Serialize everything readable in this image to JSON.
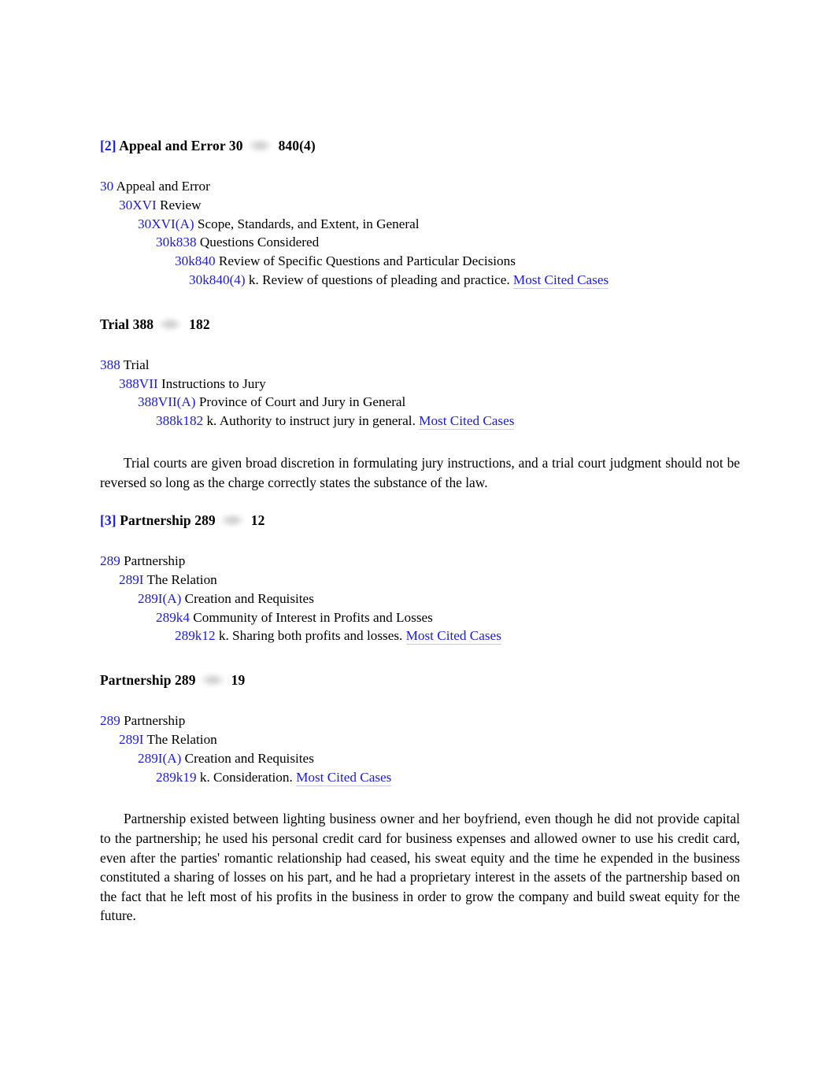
{
  "document": {
    "type": "westlaw-headnotes",
    "link_color": "#1a1ae8",
    "text_color": "#000000",
    "background": "#ffffff"
  },
  "sections": [
    {
      "header": {
        "bracket": "[2]",
        "topic": "Appeal and Error",
        "topic_number": "30",
        "key_icon": "west-key-icon",
        "key_number": "840(4)"
      },
      "outline": [
        {
          "code": "30",
          "desc": "Appeal and Error"
        },
        {
          "code": "30XVI",
          "desc": "Review"
        },
        {
          "code": "30XVI(A)",
          "desc": "Scope, Standards, and Extent, in General"
        },
        {
          "code": "30k838",
          "desc": "Questions Considered"
        },
        {
          "code": "30k840",
          "desc": "Review of Specific Questions and Particular Decisions"
        },
        {
          "code": "30k840(4)",
          "desc": "k. Review of questions of pleading and practice.",
          "link": "Most Cited Cases"
        }
      ],
      "body": null
    },
    {
      "header": {
        "bracket": "",
        "topic": "Trial",
        "topic_number": "388",
        "key_icon": "west-key-icon",
        "key_number": "182"
      },
      "outline": [
        {
          "code": "388",
          "desc": "Trial"
        },
        {
          "code": "388VII",
          "desc": "Instructions to Jury"
        },
        {
          "code": "388VII(A)",
          "desc": "Province of Court and Jury in General"
        },
        {
          "code": "388k182",
          "desc": "k. Authority to instruct jury in general.",
          "link": "Most Cited Cases"
        }
      ],
      "body": "Trial courts are given broad discretion in formulating jury instructions, and a trial court judgment should not be reversed so long as the charge correctly states the substance of the law."
    },
    {
      "header": {
        "bracket": "[3]",
        "topic": "Partnership",
        "topic_number": "289",
        "key_icon": "west-key-icon",
        "key_number": "12"
      },
      "outline": [
        {
          "code": "289",
          "desc": "Partnership"
        },
        {
          "code": "289I",
          "desc": "The Relation"
        },
        {
          "code": "289I(A)",
          "desc": "Creation and Requisites"
        },
        {
          "code": "289k4",
          "desc": "Community of Interest in Profits and Losses"
        },
        {
          "code": "289k12",
          "desc": "k. Sharing both profits and losses.",
          "link": "Most Cited Cases"
        }
      ],
      "body": null
    },
    {
      "header": {
        "bracket": "",
        "topic": "Partnership",
        "topic_number": "289",
        "key_icon": "west-key-icon",
        "key_number": "19"
      },
      "outline": [
        {
          "code": "289",
          "desc": "Partnership"
        },
        {
          "code": "289I",
          "desc": "The Relation"
        },
        {
          "code": "289I(A)",
          "desc": "Creation and Requisites"
        },
        {
          "code": "289k19",
          "desc": "k. Consideration.",
          "link": "Most Cited Cases"
        }
      ],
      "body": "Partnership existed between lighting business owner and her boyfriend, even though he did not provide capital to the partnership; he used his personal credit card for business expenses and allowed owner to use his credit card, even after the parties' romantic relationship had ceased, his sweat equity and the time he expended in the business constituted a sharing of losses on his part, and he had a proprietary interest in the assets of the partnership based on the fact that he left most of his profits in the business in order to grow the company and build sweat equity for the future."
    }
  ]
}
